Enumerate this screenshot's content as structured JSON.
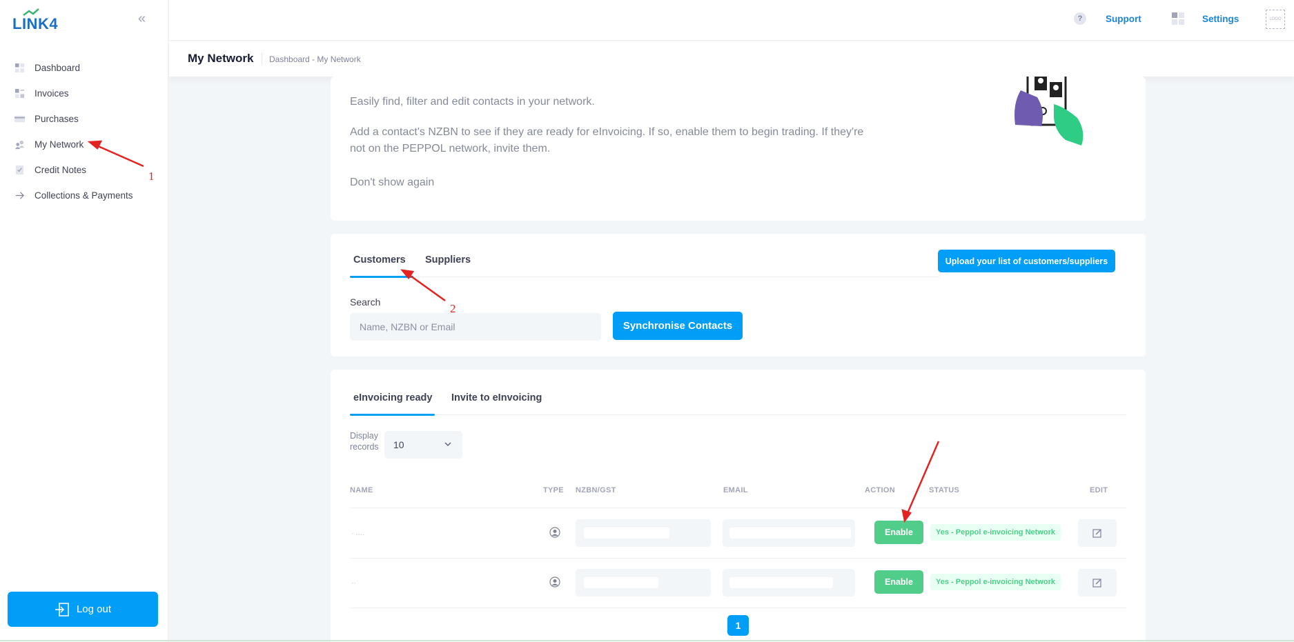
{
  "app": {
    "logo_text": "LINK4",
    "collapse_icon": "double-chevron-left-icon"
  },
  "sidebar": {
    "items": [
      {
        "label": "Dashboard",
        "icon": "dashboard-icon"
      },
      {
        "label": "Invoices",
        "icon": "invoice-icon"
      },
      {
        "label": "Purchases",
        "icon": "card-icon"
      },
      {
        "label": "My Network",
        "icon": "network-icon"
      },
      {
        "label": "Credit Notes",
        "icon": "credit-note-icon"
      },
      {
        "label": "Collections & Payments",
        "icon": "arrow-right-icon"
      }
    ],
    "logout_label": "Log out"
  },
  "header": {
    "support_label": "Support",
    "settings_label": "Settings",
    "help_glyph": "?",
    "logo_placeholder": "LOGO"
  },
  "subheader": {
    "page_title": "My Network",
    "breadcrumb": "Dashboard - My Network"
  },
  "intro": {
    "line1": "Easily find, filter and edit contacts in your network.",
    "line2": "Add a contact's NZBN to see if they are ready for eInvoicing. If so, enable them to begin trading. If they're not on the PEPPOL network, invite them.",
    "dont_show": "Don't show again"
  },
  "contacts": {
    "tabs": [
      "Customers",
      "Suppliers"
    ],
    "active_tab": "Customers",
    "upload_label": "Upload your list of customers/suppliers",
    "search_label": "Search",
    "search_placeholder": "Name, NZBN or Email",
    "sync_label": "Synchronise Contacts"
  },
  "table": {
    "tabs": [
      "eInvoicing ready",
      "Invite to eInvoicing"
    ],
    "active_tab": "eInvoicing ready",
    "display_label": "Display records",
    "display_value": "10",
    "columns": [
      "NAME",
      "TYPE",
      "NZBN/GST",
      "EMAIL",
      "ACTION",
      "STATUS",
      "EDIT"
    ],
    "rows": [
      {
        "action": "Enable",
        "status": "Yes - Peppol e-invoicing Network"
      },
      {
        "action": "Enable",
        "status": "Yes - Peppol e-invoicing Network"
      }
    ],
    "page": "1"
  },
  "annotations": {
    "labels": [
      "1",
      "2"
    ],
    "color": "#e32222"
  },
  "colors": {
    "primary": "#009ef7",
    "success": "#50cd89",
    "success_light": "#e8fff3"
  }
}
